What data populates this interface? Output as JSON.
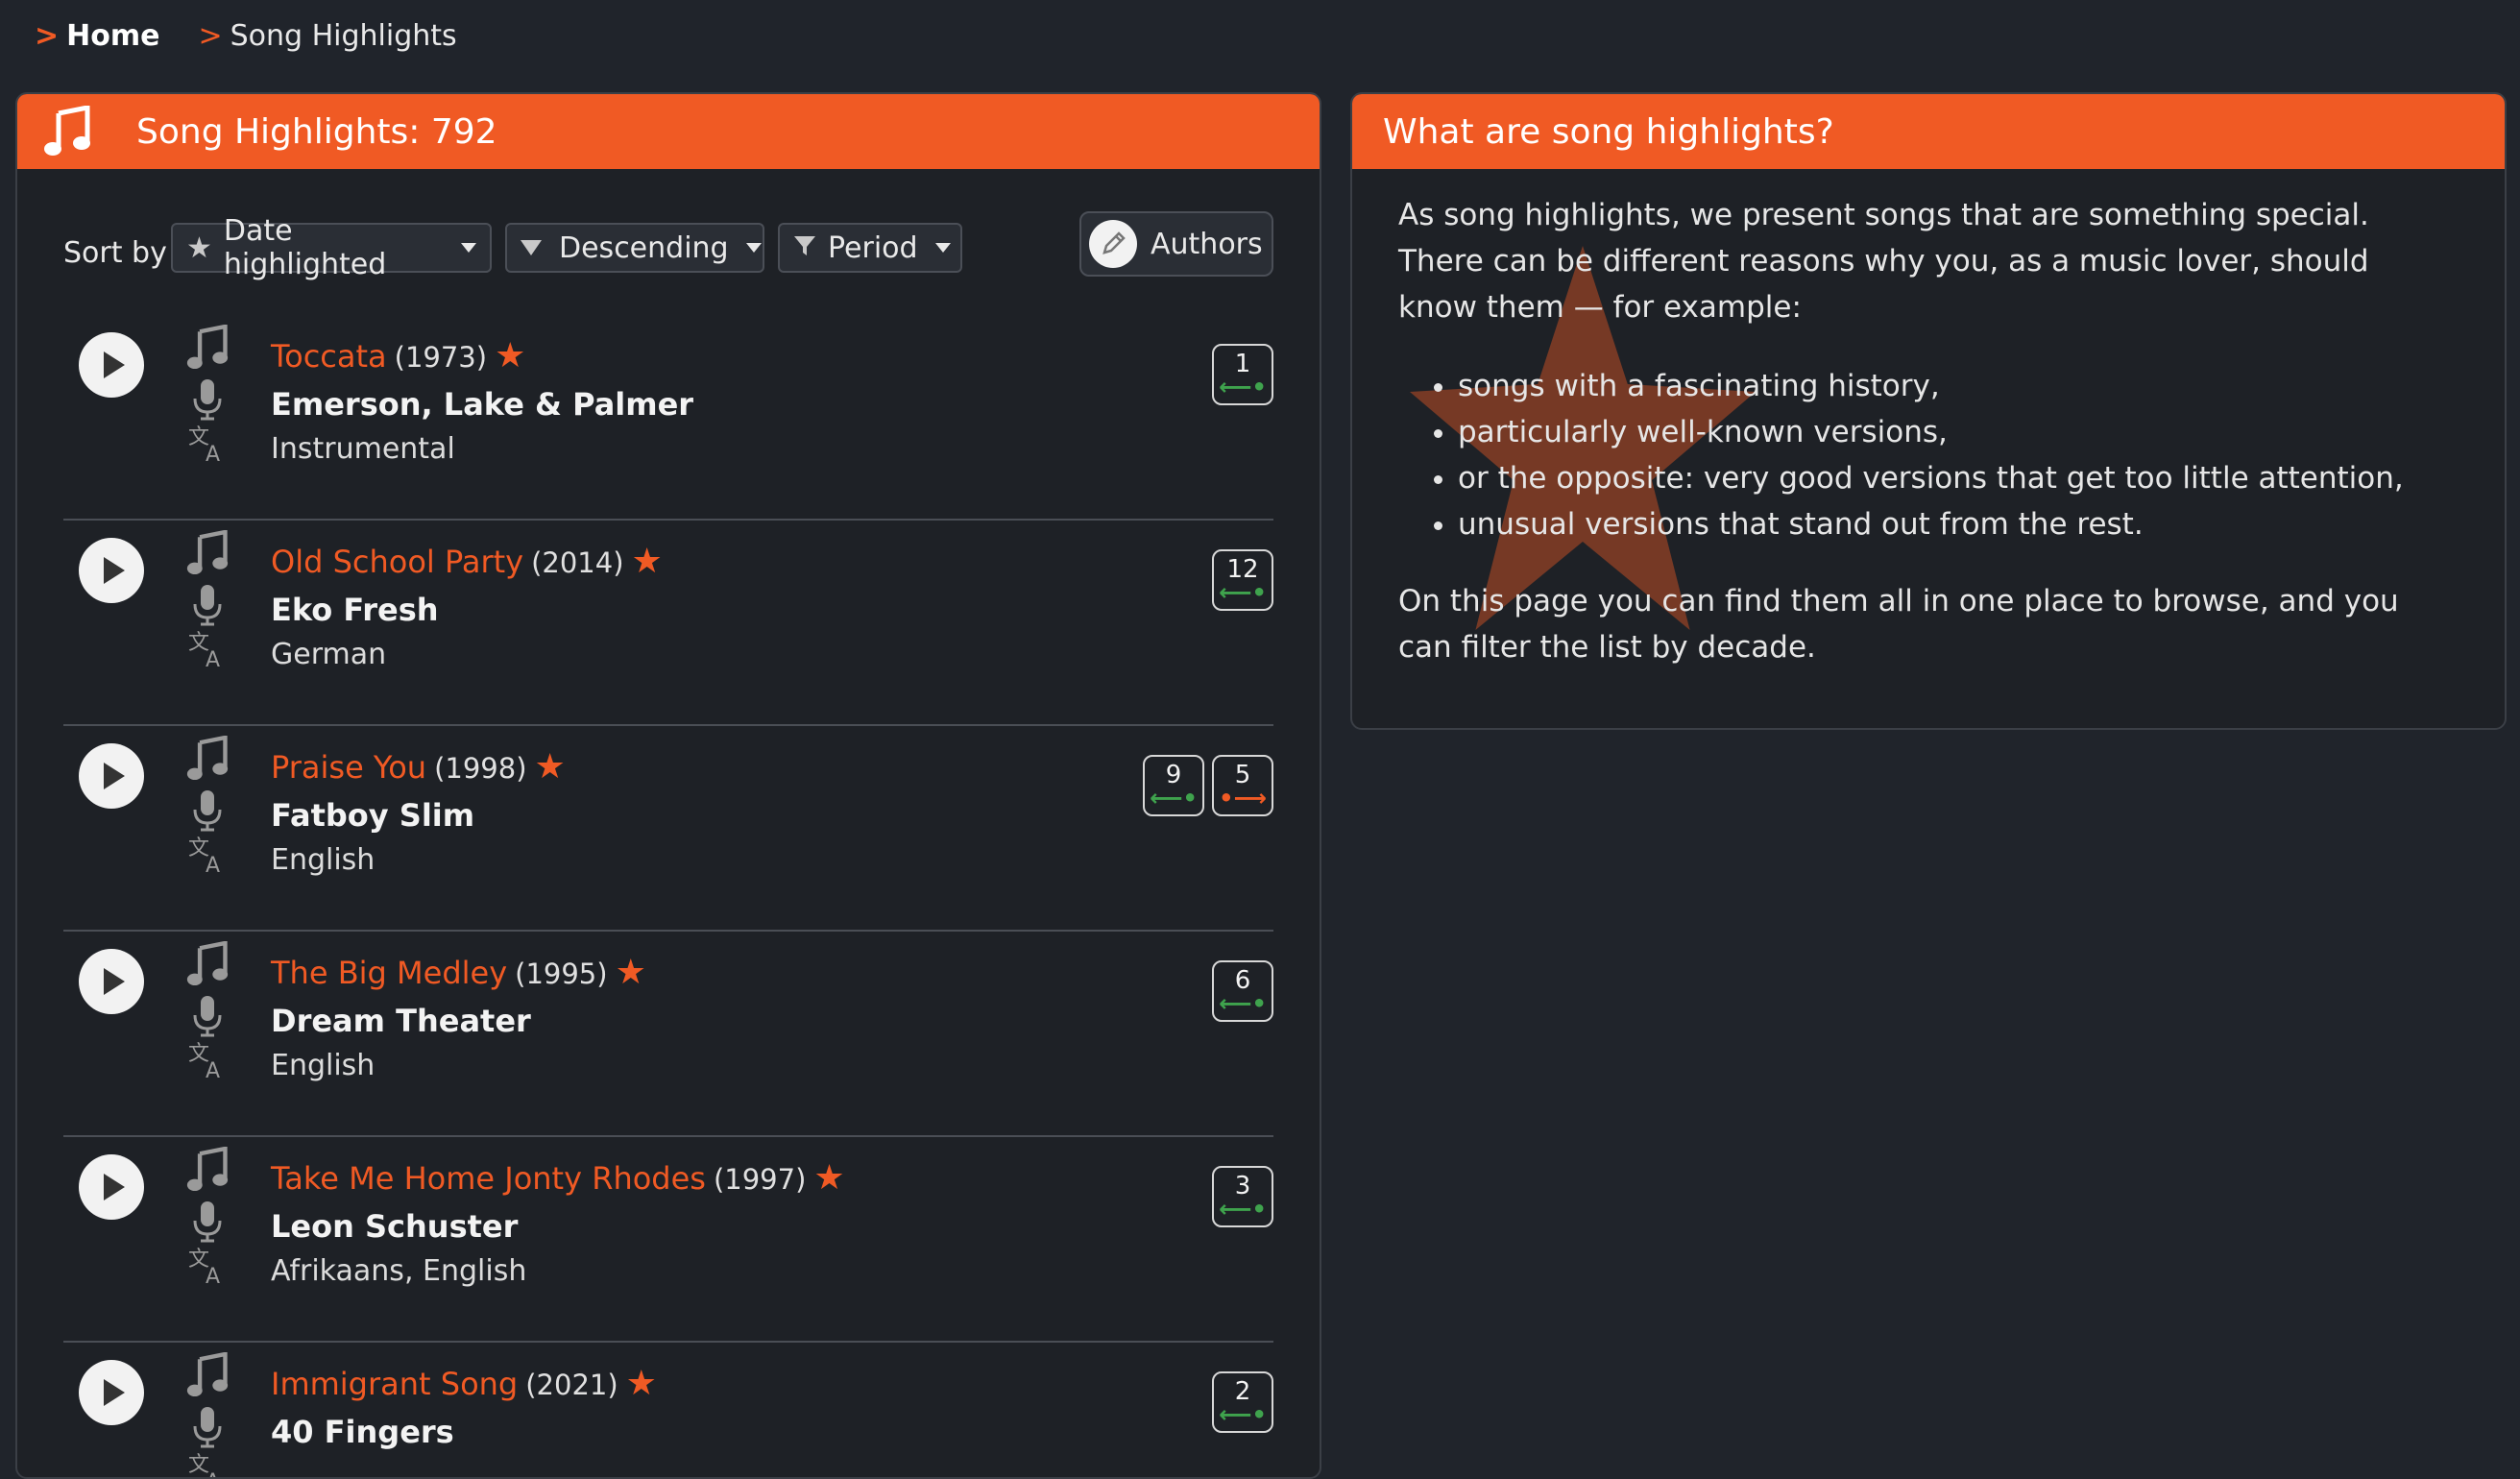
{
  "breadcrumbs": {
    "home": "Home",
    "current": "Song Highlights",
    "separator": ">"
  },
  "left_panel": {
    "title": "Song Highlights: 792",
    "sort_label": "Sort by",
    "sort_field": "Date highlighted",
    "sort_order": "Descending",
    "period": "Period",
    "authors_button": "Authors",
    "songs": [
      {
        "title": "Toccata",
        "year": "(1973)",
        "artist": "Emerson, Lake & Palmer",
        "language": "Instrumental",
        "badges": [
          {
            "count": "1",
            "direction": "in"
          }
        ]
      },
      {
        "title": "Old School Party",
        "year": "(2014)",
        "artist": "Eko Fresh",
        "language": "German",
        "badges": [
          {
            "count": "12",
            "direction": "in"
          }
        ]
      },
      {
        "title": "Praise You",
        "year": "(1998)",
        "artist": "Fatboy Slim",
        "language": "English",
        "badges": [
          {
            "count": "9",
            "direction": "in"
          },
          {
            "count": "5",
            "direction": "out"
          }
        ]
      },
      {
        "title": "The Big Medley",
        "year": "(1995)",
        "artist": "Dream Theater",
        "language": "English",
        "badges": [
          {
            "count": "6",
            "direction": "in"
          }
        ]
      },
      {
        "title": "Take Me Home Jonty Rhodes",
        "year": "(1997)",
        "artist": "Leon Schuster",
        "language": "Afrikaans, English",
        "badges": [
          {
            "count": "3",
            "direction": "in"
          }
        ]
      },
      {
        "title": "Immigrant Song",
        "year": "(2021)",
        "artist": "40 Fingers",
        "language": "",
        "badges": [
          {
            "count": "2",
            "direction": "in"
          }
        ]
      }
    ]
  },
  "right_panel": {
    "title": "What are song highlights?",
    "intro": "As song highlights, we present songs that are something special. There can be different reasons why you, as a music lover, should know them — for example:",
    "reasons": [
      "songs with a fascinating history,",
      "particularly well-known versions,",
      "or the opposite: very good versions that get too little attention,",
      "unusual versions that stand out from the rest."
    ],
    "outro": "On this page you can find them all in one place to browse, and you can filter the list by decade."
  },
  "colors": {
    "accent": "#f05a24",
    "background": "#20242b",
    "arrow_in": "#3fa34d",
    "arrow_out": "#f05a24"
  },
  "icons": [
    "music-note-icon",
    "microphone-icon",
    "language-icon",
    "play-icon",
    "star-icon",
    "pencil-icon",
    "funnel-icon"
  ]
}
